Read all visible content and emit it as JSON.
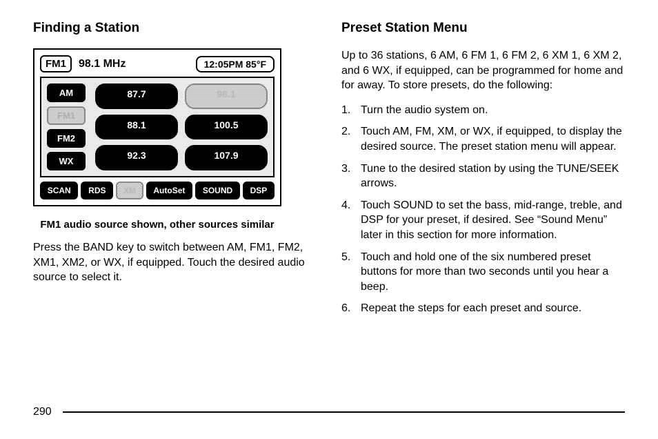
{
  "left": {
    "heading": "Finding a Station",
    "caption": "FM1 audio source shown, other sources similar",
    "para": "Press the BAND key to switch between AM, FM1, FM2, XM1, XM2, or WX, if equipped. Touch the desired audio source to select it."
  },
  "radio": {
    "band_chip": "FM1",
    "freq": "98.1 MHz",
    "clock": "12:05PM 85°F",
    "sources": [
      "AM",
      "FM1",
      "FM2",
      "WX"
    ],
    "selected_source_index": 1,
    "presets": [
      "87.7",
      "98.1",
      "88.1",
      "100.5",
      "92.3",
      "107.9"
    ],
    "selected_preset_index": 1,
    "fn": [
      "SCAN",
      "RDS",
      "XM",
      "AutoSet",
      "SOUND",
      "DSP"
    ],
    "selected_fn_index": 2
  },
  "right": {
    "heading": "Preset Station Menu",
    "intro": "Up to 36 stations, 6 AM, 6 FM 1, 6 FM 2, 6 XM 1, 6 XM 2, and 6 WX, if equipped, can be programmed for home and for away. To store presets, do the following:",
    "steps": [
      "Turn the audio system on.",
      "Touch AM, FM, XM, or WX, if equipped, to display the desired source. The preset station menu will appear.",
      "Tune to the desired station by using the TUNE/SEEK arrows.",
      "Touch SOUND to set the bass, mid-range, treble, and DSP for your preset, if desired. See “Sound Menu” later in this section for more information.",
      "Touch and hold one of the six numbered preset buttons for more than two seconds until you hear a beep.",
      "Repeat the steps for each preset and source."
    ]
  },
  "page_number": "290"
}
